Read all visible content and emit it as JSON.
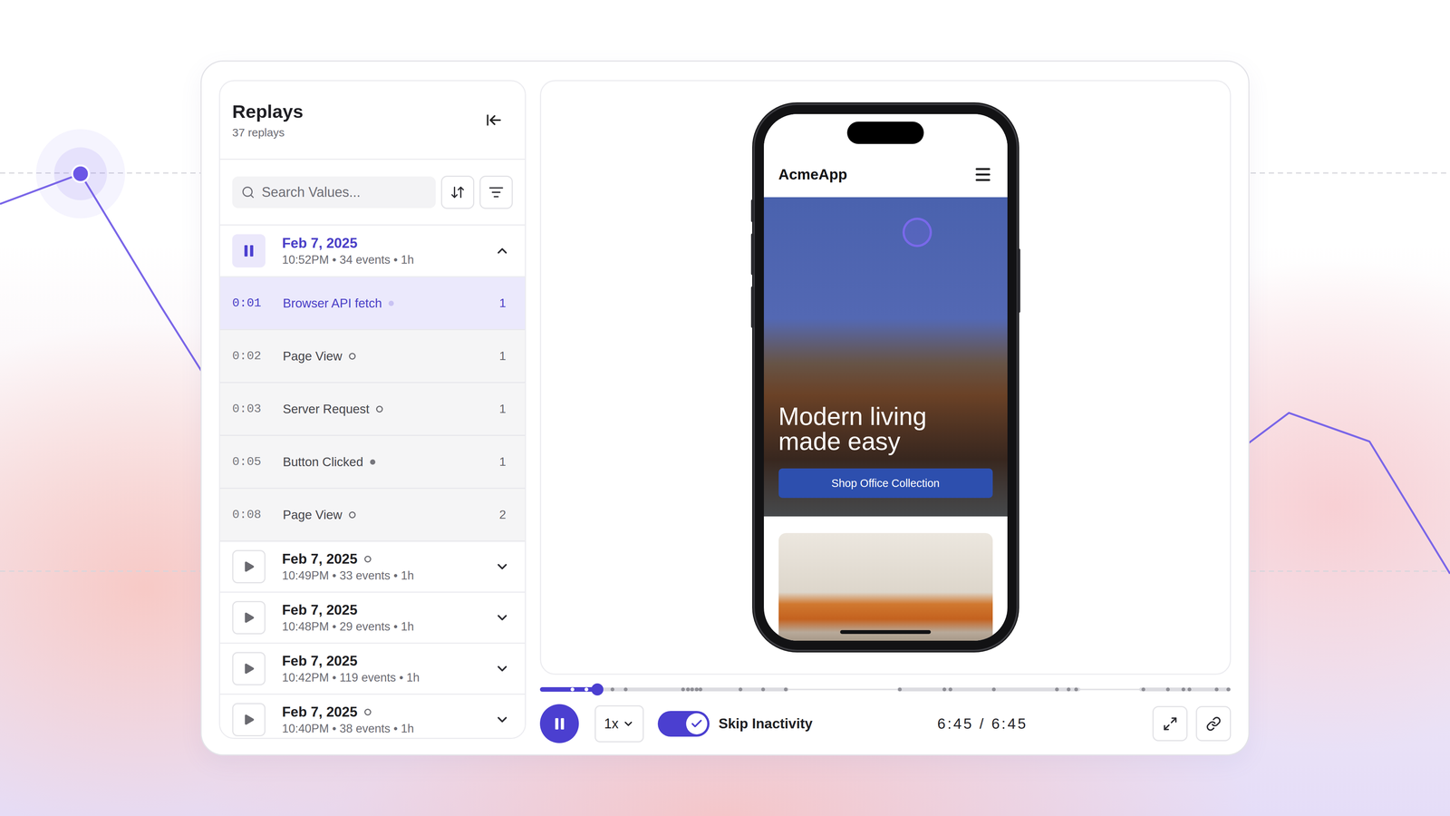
{
  "panel": {
    "title": "Replays",
    "subtitle": "37 replays"
  },
  "search": {
    "placeholder": "Search Values..."
  },
  "sessions": [
    {
      "date": "Feb 7, 2025",
      "meta": "10:52PM • 34 events • 1h",
      "expanded": true,
      "playing": true,
      "marker": "none",
      "events": [
        {
          "time": "0:01",
          "label": "Browser API fetch",
          "count": "1",
          "marker": "filled",
          "selected": true
        },
        {
          "time": "0:02",
          "label": "Page View",
          "count": "1",
          "marker": "hollow",
          "selected": false
        },
        {
          "time": "0:03",
          "label": "Server Request",
          "count": "1",
          "marker": "hollow",
          "selected": false
        },
        {
          "time": "0:05",
          "label": "Button Clicked",
          "count": "1",
          "marker": "filled",
          "selected": false
        },
        {
          "time": "0:08",
          "label": "Page View",
          "count": "2",
          "marker": "hollow",
          "selected": false
        }
      ]
    },
    {
      "date": "Feb 7, 2025",
      "meta": "10:49PM • 33 events • 1h",
      "expanded": false,
      "playing": false,
      "marker": "hollow",
      "events": []
    },
    {
      "date": "Feb 7, 2025",
      "meta": "10:48PM • 29 events • 1h",
      "expanded": false,
      "playing": false,
      "marker": "none",
      "events": []
    },
    {
      "date": "Feb 7, 2025",
      "meta": "10:42PM • 119 events • 1h",
      "expanded": false,
      "playing": false,
      "marker": "none",
      "events": []
    },
    {
      "date": "Feb 7, 2025",
      "meta": "10:40PM • 38 events • 1h",
      "expanded": false,
      "playing": false,
      "marker": "hollow",
      "events": []
    }
  ],
  "replay_app": {
    "brand": "AcmeApp",
    "hero_title": "Modern living made easy",
    "cta": "Shop Office Collection"
  },
  "player": {
    "playing": true,
    "level": 0.083,
    "markers": [
      0.047,
      0.067,
      0.105,
      0.124,
      0.207,
      0.214,
      0.22,
      0.227,
      0.232,
      0.29,
      0.323,
      0.356,
      0.521,
      0.585,
      0.594,
      0.657,
      0.748,
      0.765,
      0.776,
      0.873,
      0.909,
      0.931,
      0.94,
      0.979,
      0.996
    ],
    "segments": [
      [
        0,
        0.36
      ],
      [
        0.517,
        0.782
      ],
      [
        0.867,
        1
      ]
    ],
    "speed": "1x",
    "skip_inactivity": {
      "label": "Skip Inactivity",
      "on": true
    },
    "time": "6:45 / 6:45"
  },
  "backdrop_chart": {
    "values": [
      75,
      78.7,
      62.4,
      46.7,
      40,
      35,
      45,
      30,
      38,
      50,
      42,
      36,
      44,
      48,
      46,
      42,
      49.4,
      45.9,
      29.7
    ],
    "highlight": 1,
    "grid": [
      78.8,
      30
    ]
  }
}
